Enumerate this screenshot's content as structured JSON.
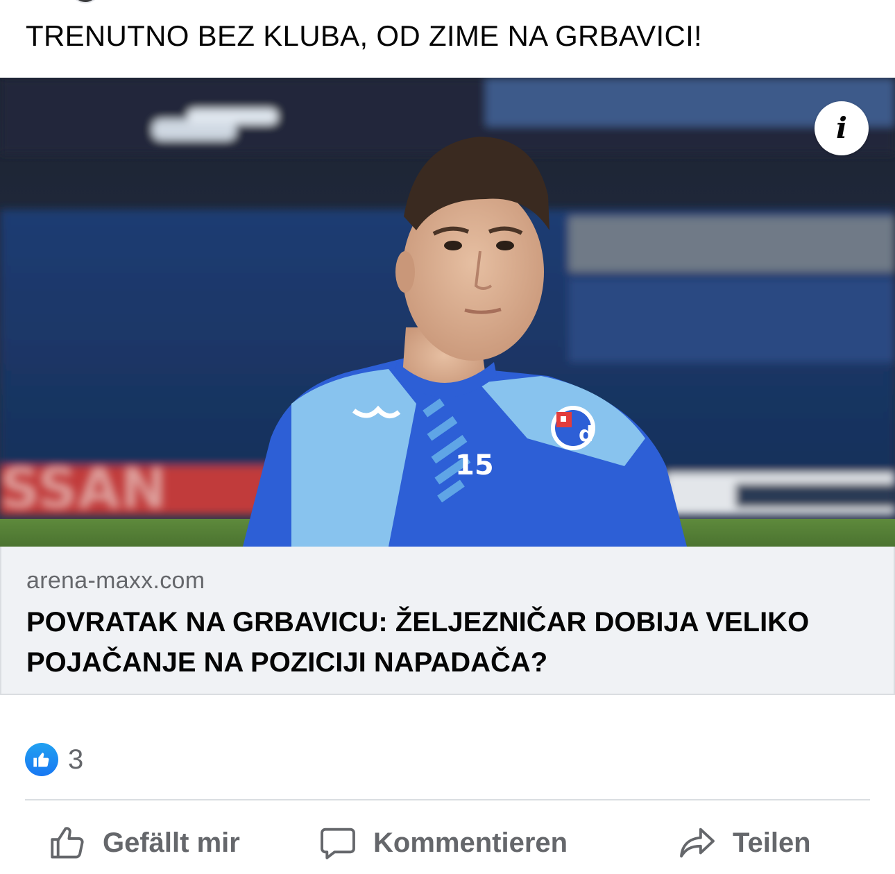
{
  "post": {
    "text": "TRENUTNO BEZ KLUBA, OD ZIME NA GRBAVICI!"
  },
  "link_preview": {
    "image_alt": "Football player in blue training top with number 15",
    "jersey_number": "15",
    "ad_board_text": "SSAN",
    "domain": "arena-maxx.com",
    "title": "POVRATAK NA GRBAVICU: ŽELJEZNIČAR DOBIJA VELIKO POJAČANJE NA POZICIJI NAPADAČA?",
    "info_icon": "info-icon"
  },
  "reactions": {
    "icon": "like-icon",
    "count": "3"
  },
  "actions": {
    "like_label": "Gefällt mir",
    "comment_label": "Kommentieren",
    "share_label": "Teilen"
  },
  "colors": {
    "brand_blue": "#1877f2",
    "secondary_text": "#65676b",
    "card_background": "#f0f2f5"
  }
}
